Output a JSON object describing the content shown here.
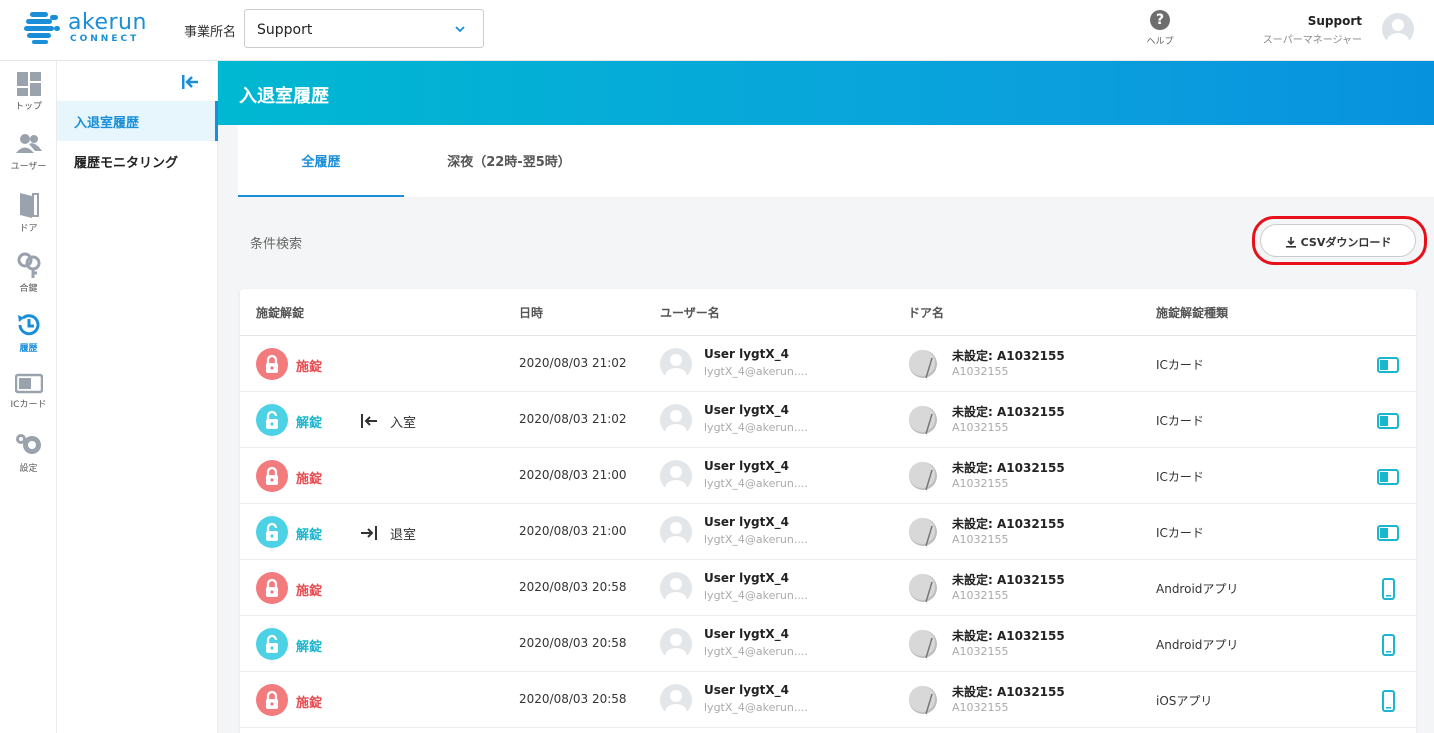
{
  "header": {
    "logo_word": "akerun",
    "logo_sub": "CONNECT",
    "office_label": "事業所名",
    "office_value": "Support",
    "help_label": "ヘルプ",
    "help_glyph": "?",
    "user_name": "Support",
    "user_role": "スーパーマネージャー"
  },
  "rail": [
    {
      "label": "トップ",
      "icon": "dashboard-icon"
    },
    {
      "label": "ユーザー",
      "icon": "users-icon"
    },
    {
      "label": "ドア",
      "icon": "door-icon"
    },
    {
      "label": "合鍵",
      "icon": "key-icon"
    },
    {
      "label": "履歴",
      "icon": "history-icon",
      "active": true
    },
    {
      "label": "ICカード",
      "icon": "ic-card-icon"
    },
    {
      "label": "設定",
      "icon": "gear-icon"
    }
  ],
  "subnav": {
    "items": [
      {
        "label": "入退室履歴",
        "active": true
      },
      {
        "label": "履歴モニタリング",
        "active": false
      }
    ]
  },
  "page": {
    "title": "入退室履歴",
    "tabs": [
      {
        "label": "全履歴",
        "active": true
      },
      {
        "label": "深夜（22時-翌5時）",
        "active": false
      }
    ],
    "condition_label": "条件検索",
    "csv_label": "CSVダウンロード"
  },
  "table": {
    "columns": [
      "施錠解錠",
      "日時",
      "ユーザー名",
      "ドア名",
      "施錠解錠種類"
    ],
    "rows": [
      {
        "action": "施錠",
        "state": "locked",
        "direction": "",
        "dir_type": "",
        "datetime": "2020/08/03 21:02",
        "user": "User lygtX_4",
        "email": "lygtX_4@akerun....",
        "door": "未設定: A1032155",
        "door_id": "A1032155",
        "method": "ICカード",
        "method_icon": "card-icon"
      },
      {
        "action": "解錠",
        "state": "unlocked",
        "direction": "入室",
        "dir_type": "enter",
        "datetime": "2020/08/03 21:02",
        "user": "User lygtX_4",
        "email": "lygtX_4@akerun....",
        "door": "未設定: A1032155",
        "door_id": "A1032155",
        "method": "ICカード",
        "method_icon": "card-icon"
      },
      {
        "action": "施錠",
        "state": "locked",
        "direction": "",
        "dir_type": "",
        "datetime": "2020/08/03 21:00",
        "user": "User lygtX_4",
        "email": "lygtX_4@akerun....",
        "door": "未設定: A1032155",
        "door_id": "A1032155",
        "method": "ICカード",
        "method_icon": "card-icon"
      },
      {
        "action": "解錠",
        "state": "unlocked",
        "direction": "退室",
        "dir_type": "exit",
        "datetime": "2020/08/03 21:00",
        "user": "User lygtX_4",
        "email": "lygtX_4@akerun....",
        "door": "未設定: A1032155",
        "door_id": "A1032155",
        "method": "ICカード",
        "method_icon": "card-icon"
      },
      {
        "action": "施錠",
        "state": "locked",
        "direction": "",
        "dir_type": "",
        "datetime": "2020/08/03 20:58",
        "user": "User lygtX_4",
        "email": "lygtX_4@akerun....",
        "door": "未設定: A1032155",
        "door_id": "A1032155",
        "method": "Androidアプリ",
        "method_icon": "phone-icon"
      },
      {
        "action": "解錠",
        "state": "unlocked",
        "direction": "",
        "dir_type": "",
        "datetime": "2020/08/03 20:58",
        "user": "User lygtX_4",
        "email": "lygtX_4@akerun....",
        "door": "未設定: A1032155",
        "door_id": "A1032155",
        "method": "Androidアプリ",
        "method_icon": "phone-icon"
      },
      {
        "action": "施錠",
        "state": "locked",
        "direction": "",
        "dir_type": "",
        "datetime": "2020/08/03 20:58",
        "user": "User lygtX_4",
        "email": "lygtX_4@akerun....",
        "door": "未設定: A1032155",
        "door_id": "A1032155",
        "method": "iOSアプリ",
        "method_icon": "phone-icon"
      }
    ]
  },
  "colors": {
    "accent": "#1a8fd8",
    "locked": "#e84b50",
    "unlocked": "#1ab6cf",
    "highlight": "#e8101a"
  }
}
